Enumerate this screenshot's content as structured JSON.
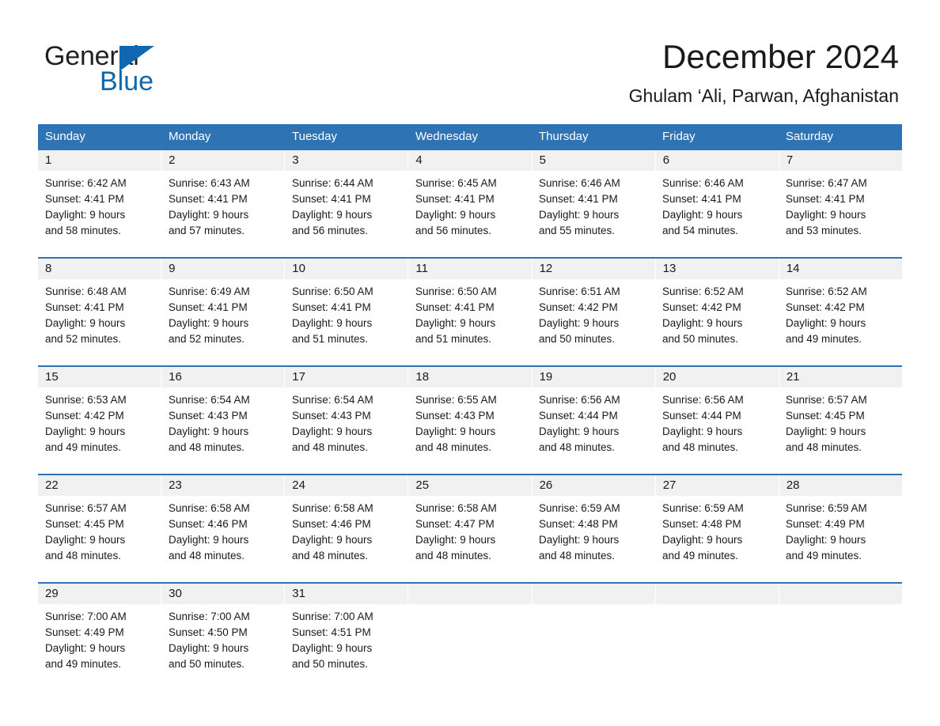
{
  "brand": {
    "name_part1": "General",
    "name_part2": "Blue",
    "triangle_icon": "blue-triangle-icon",
    "accent_color": "#1068b0"
  },
  "header": {
    "title": "December 2024",
    "location": "Ghulam ‘Ali, Parwan, Afghanistan"
  },
  "theme": {
    "header_blue": "#2e74b5",
    "day_band_gray": "#f1f1f1",
    "text_color": "#1a1a1a"
  },
  "calendar": {
    "weekday_headers": [
      "Sunday",
      "Monday",
      "Tuesday",
      "Wednesday",
      "Thursday",
      "Friday",
      "Saturday"
    ],
    "weeks": [
      {
        "days": [
          {
            "day": "1",
            "sunrise": "Sunrise: 6:42 AM",
            "sunset": "Sunset: 4:41 PM",
            "daylight_line1": "Daylight: 9 hours",
            "daylight_line2": "and 58 minutes."
          },
          {
            "day": "2",
            "sunrise": "Sunrise: 6:43 AM",
            "sunset": "Sunset: 4:41 PM",
            "daylight_line1": "Daylight: 9 hours",
            "daylight_line2": "and 57 minutes."
          },
          {
            "day": "3",
            "sunrise": "Sunrise: 6:44 AM",
            "sunset": "Sunset: 4:41 PM",
            "daylight_line1": "Daylight: 9 hours",
            "daylight_line2": "and 56 minutes."
          },
          {
            "day": "4",
            "sunrise": "Sunrise: 6:45 AM",
            "sunset": "Sunset: 4:41 PM",
            "daylight_line1": "Daylight: 9 hours",
            "daylight_line2": "and 56 minutes."
          },
          {
            "day": "5",
            "sunrise": "Sunrise: 6:46 AM",
            "sunset": "Sunset: 4:41 PM",
            "daylight_line1": "Daylight: 9 hours",
            "daylight_line2": "and 55 minutes."
          },
          {
            "day": "6",
            "sunrise": "Sunrise: 6:46 AM",
            "sunset": "Sunset: 4:41 PM",
            "daylight_line1": "Daylight: 9 hours",
            "daylight_line2": "and 54 minutes."
          },
          {
            "day": "7",
            "sunrise": "Sunrise: 6:47 AM",
            "sunset": "Sunset: 4:41 PM",
            "daylight_line1": "Daylight: 9 hours",
            "daylight_line2": "and 53 minutes."
          }
        ]
      },
      {
        "days": [
          {
            "day": "8",
            "sunrise": "Sunrise: 6:48 AM",
            "sunset": "Sunset: 4:41 PM",
            "daylight_line1": "Daylight: 9 hours",
            "daylight_line2": "and 52 minutes."
          },
          {
            "day": "9",
            "sunrise": "Sunrise: 6:49 AM",
            "sunset": "Sunset: 4:41 PM",
            "daylight_line1": "Daylight: 9 hours",
            "daylight_line2": "and 52 minutes."
          },
          {
            "day": "10",
            "sunrise": "Sunrise: 6:50 AM",
            "sunset": "Sunset: 4:41 PM",
            "daylight_line1": "Daylight: 9 hours",
            "daylight_line2": "and 51 minutes."
          },
          {
            "day": "11",
            "sunrise": "Sunrise: 6:50 AM",
            "sunset": "Sunset: 4:41 PM",
            "daylight_line1": "Daylight: 9 hours",
            "daylight_line2": "and 51 minutes."
          },
          {
            "day": "12",
            "sunrise": "Sunrise: 6:51 AM",
            "sunset": "Sunset: 4:42 PM",
            "daylight_line1": "Daylight: 9 hours",
            "daylight_line2": "and 50 minutes."
          },
          {
            "day": "13",
            "sunrise": "Sunrise: 6:52 AM",
            "sunset": "Sunset: 4:42 PM",
            "daylight_line1": "Daylight: 9 hours",
            "daylight_line2": "and 50 minutes."
          },
          {
            "day": "14",
            "sunrise": "Sunrise: 6:52 AM",
            "sunset": "Sunset: 4:42 PM",
            "daylight_line1": "Daylight: 9 hours",
            "daylight_line2": "and 49 minutes."
          }
        ]
      },
      {
        "days": [
          {
            "day": "15",
            "sunrise": "Sunrise: 6:53 AM",
            "sunset": "Sunset: 4:42 PM",
            "daylight_line1": "Daylight: 9 hours",
            "daylight_line2": "and 49 minutes."
          },
          {
            "day": "16",
            "sunrise": "Sunrise: 6:54 AM",
            "sunset": "Sunset: 4:43 PM",
            "daylight_line1": "Daylight: 9 hours",
            "daylight_line2": "and 48 minutes."
          },
          {
            "day": "17",
            "sunrise": "Sunrise: 6:54 AM",
            "sunset": "Sunset: 4:43 PM",
            "daylight_line1": "Daylight: 9 hours",
            "daylight_line2": "and 48 minutes."
          },
          {
            "day": "18",
            "sunrise": "Sunrise: 6:55 AM",
            "sunset": "Sunset: 4:43 PM",
            "daylight_line1": "Daylight: 9 hours",
            "daylight_line2": "and 48 minutes."
          },
          {
            "day": "19",
            "sunrise": "Sunrise: 6:56 AM",
            "sunset": "Sunset: 4:44 PM",
            "daylight_line1": "Daylight: 9 hours",
            "daylight_line2": "and 48 minutes."
          },
          {
            "day": "20",
            "sunrise": "Sunrise: 6:56 AM",
            "sunset": "Sunset: 4:44 PM",
            "daylight_line1": "Daylight: 9 hours",
            "daylight_line2": "and 48 minutes."
          },
          {
            "day": "21",
            "sunrise": "Sunrise: 6:57 AM",
            "sunset": "Sunset: 4:45 PM",
            "daylight_line1": "Daylight: 9 hours",
            "daylight_line2": "and 48 minutes."
          }
        ]
      },
      {
        "days": [
          {
            "day": "22",
            "sunrise": "Sunrise: 6:57 AM",
            "sunset": "Sunset: 4:45 PM",
            "daylight_line1": "Daylight: 9 hours",
            "daylight_line2": "and 48 minutes."
          },
          {
            "day": "23",
            "sunrise": "Sunrise: 6:58 AM",
            "sunset": "Sunset: 4:46 PM",
            "daylight_line1": "Daylight: 9 hours",
            "daylight_line2": "and 48 minutes."
          },
          {
            "day": "24",
            "sunrise": "Sunrise: 6:58 AM",
            "sunset": "Sunset: 4:46 PM",
            "daylight_line1": "Daylight: 9 hours",
            "daylight_line2": "and 48 minutes."
          },
          {
            "day": "25",
            "sunrise": "Sunrise: 6:58 AM",
            "sunset": "Sunset: 4:47 PM",
            "daylight_line1": "Daylight: 9 hours",
            "daylight_line2": "and 48 minutes."
          },
          {
            "day": "26",
            "sunrise": "Sunrise: 6:59 AM",
            "sunset": "Sunset: 4:48 PM",
            "daylight_line1": "Daylight: 9 hours",
            "daylight_line2": "and 48 minutes."
          },
          {
            "day": "27",
            "sunrise": "Sunrise: 6:59 AM",
            "sunset": "Sunset: 4:48 PM",
            "daylight_line1": "Daylight: 9 hours",
            "daylight_line2": "and 49 minutes."
          },
          {
            "day": "28",
            "sunrise": "Sunrise: 6:59 AM",
            "sunset": "Sunset: 4:49 PM",
            "daylight_line1": "Daylight: 9 hours",
            "daylight_line2": "and 49 minutes."
          }
        ]
      },
      {
        "days": [
          {
            "day": "29",
            "sunrise": "Sunrise: 7:00 AM",
            "sunset": "Sunset: 4:49 PM",
            "daylight_line1": "Daylight: 9 hours",
            "daylight_line2": "and 49 minutes."
          },
          {
            "day": "30",
            "sunrise": "Sunrise: 7:00 AM",
            "sunset": "Sunset: 4:50 PM",
            "daylight_line1": "Daylight: 9 hours",
            "daylight_line2": "and 50 minutes."
          },
          {
            "day": "31",
            "sunrise": "Sunrise: 7:00 AM",
            "sunset": "Sunset: 4:51 PM",
            "daylight_line1": "Daylight: 9 hours",
            "daylight_line2": "and 50 minutes."
          },
          {
            "day": "",
            "sunrise": "",
            "sunset": "",
            "daylight_line1": "",
            "daylight_line2": ""
          },
          {
            "day": "",
            "sunrise": "",
            "sunset": "",
            "daylight_line1": "",
            "daylight_line2": ""
          },
          {
            "day": "",
            "sunrise": "",
            "sunset": "",
            "daylight_line1": "",
            "daylight_line2": ""
          },
          {
            "day": "",
            "sunrise": "",
            "sunset": "",
            "daylight_line1": "",
            "daylight_line2": ""
          }
        ]
      }
    ]
  }
}
